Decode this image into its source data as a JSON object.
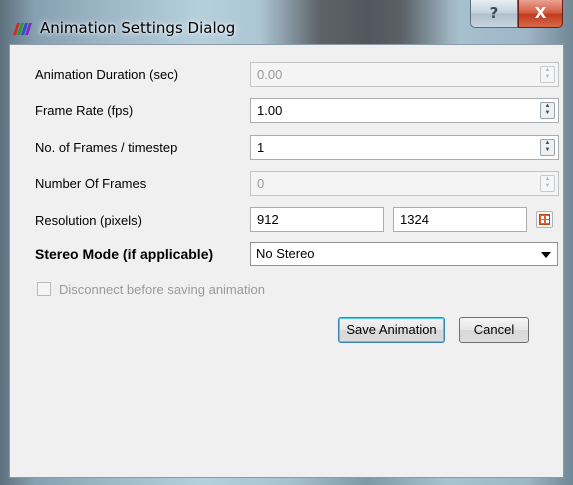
{
  "window": {
    "title": "Animation Settings Dialog",
    "help_glyph": "?",
    "close_glyph": "X"
  },
  "form": {
    "animation_duration": {
      "label": "Animation Duration (sec)",
      "value": "0.00",
      "enabled": false
    },
    "frame_rate": {
      "label": "Frame Rate (fps)",
      "value": "1.00",
      "enabled": true
    },
    "frames_per_timestep": {
      "label": "No. of Frames / timestep",
      "value": "1",
      "enabled": true
    },
    "number_of_frames": {
      "label": "Number Of Frames",
      "value": "0",
      "enabled": false
    },
    "resolution": {
      "label": "Resolution (pixels)",
      "width": "912",
      "height": "1324"
    },
    "stereo_mode": {
      "label": "Stereo Mode (if applicable)",
      "value": "No Stereo"
    },
    "disconnect": {
      "label": "Disconnect before saving animation",
      "checked": false,
      "enabled": false
    }
  },
  "buttons": {
    "save_label": "Save Animation",
    "cancel_label": "Cancel"
  },
  "icons": {
    "app": "paraview-logo-icon",
    "spin": "spin-up-down-icon",
    "lock_aspect": "lock-aspect-icon"
  },
  "colors": {
    "close_button": "#c0391d",
    "dialog_bg": "#f0f0f0",
    "default_button_focus": "#48d0f7",
    "aspect_icon": "#e2612b"
  }
}
